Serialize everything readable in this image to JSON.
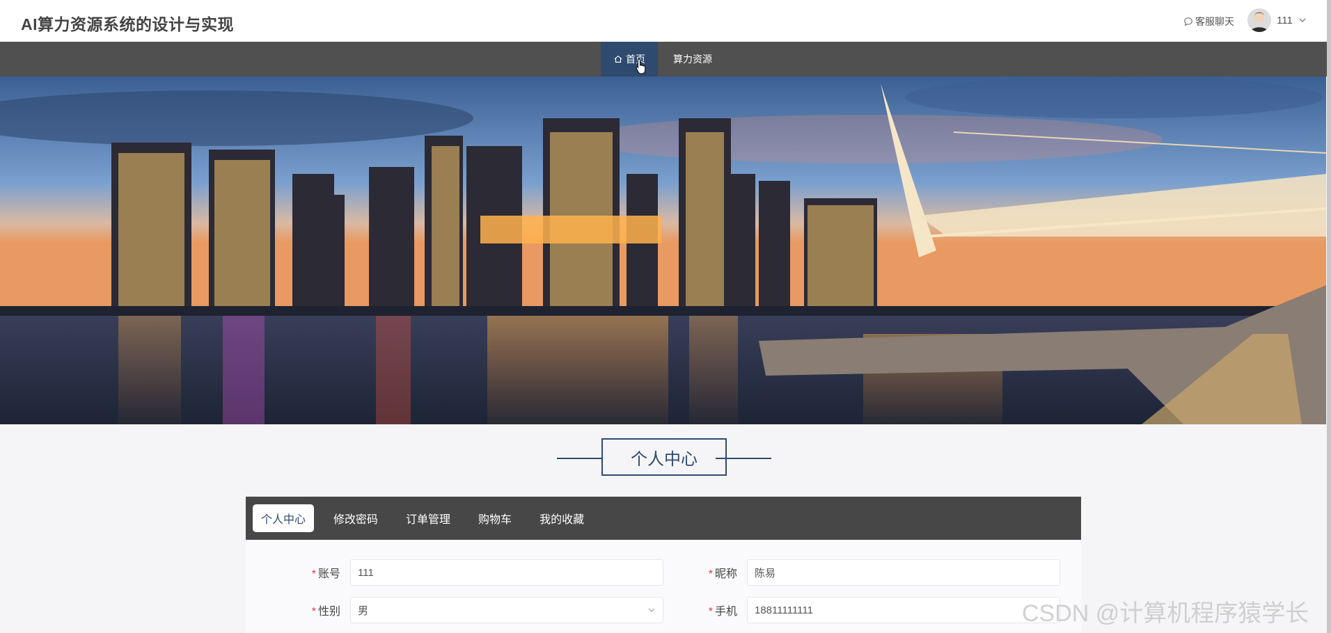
{
  "header": {
    "title": "AI算力资源系统的设计与实现",
    "chat_label": "客服聊天",
    "user_name": "111"
  },
  "nav": {
    "items": [
      {
        "label": "首页",
        "icon": "home-icon",
        "active": true
      },
      {
        "label": "算力资源",
        "active": false
      }
    ],
    "accent_color": "#2e4a6e"
  },
  "section": {
    "title": "个人中心"
  },
  "tabs": [
    {
      "label": "个人中心",
      "active": true
    },
    {
      "label": "修改密码",
      "active": false
    },
    {
      "label": "订单管理",
      "active": false
    },
    {
      "label": "购物车",
      "active": false
    },
    {
      "label": "我的收藏",
      "active": false
    }
  ],
  "form": {
    "account": {
      "label": "账号",
      "value": "111"
    },
    "nickname": {
      "label": "昵称",
      "value": "陈易"
    },
    "gender": {
      "label": "性别",
      "value": "男"
    },
    "phone": {
      "label": "手机",
      "value": "18811111111"
    }
  },
  "watermark": "CSDN @计算机程序猿学长"
}
